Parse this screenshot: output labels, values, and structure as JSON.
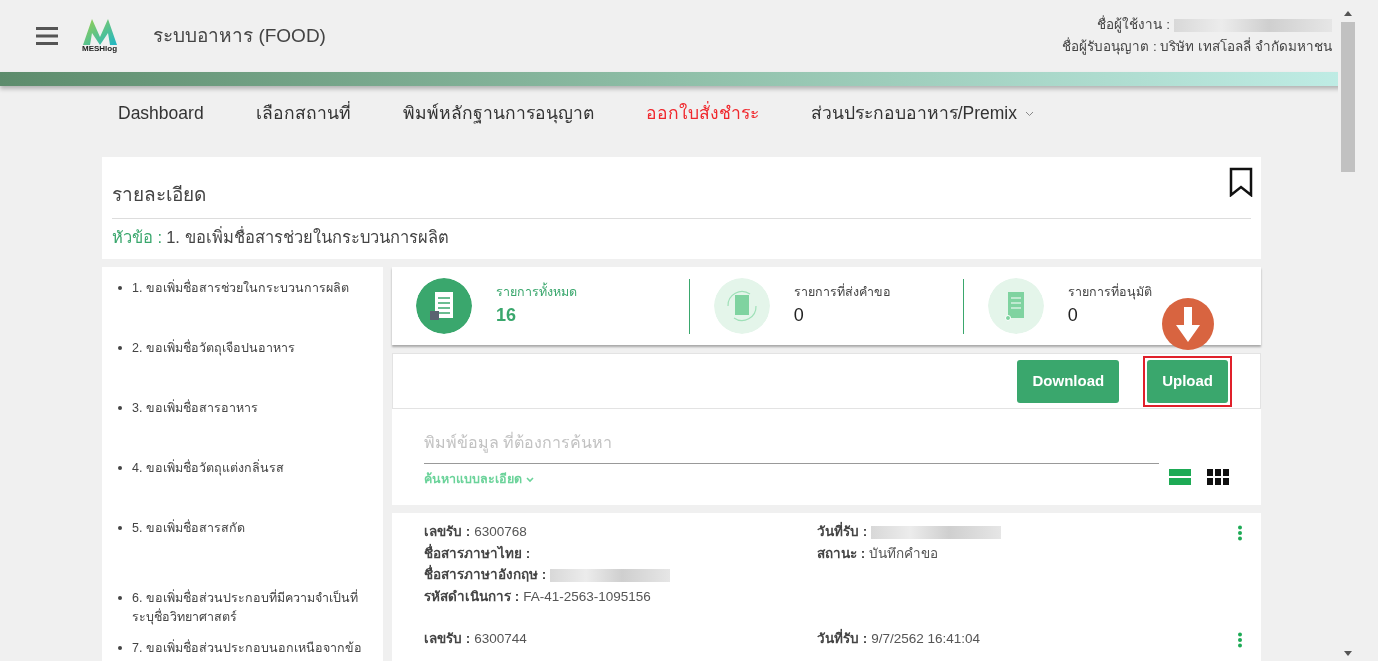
{
  "header": {
    "app_title": "ระบบอาหาร (FOOD)",
    "logo_text": "MESHlog",
    "user_label": "ชื่อผู้ใช้งาน :",
    "user_blurred": true,
    "licensee": "ชื่อผู้รับอนุญาต : บริษัท เทสโอลลี่ จำกัดมหาชน"
  },
  "nav": [
    {
      "label": "Dashboard",
      "selected": false,
      "kind": "link"
    },
    {
      "label": "เลือกสถานที่",
      "selected": false,
      "kind": "link"
    },
    {
      "label": "พิมพ์หลักฐานการอนุญาต",
      "selected": false,
      "kind": "link"
    },
    {
      "label": "ออกใบสั่งชำระ",
      "selected": true,
      "kind": "link"
    },
    {
      "label": "ส่วนประกอบอาหาร/Premix",
      "selected": false,
      "kind": "menu"
    }
  ],
  "detail": {
    "title": "รายละเอียด",
    "topic_label": "หัวข้อ :",
    "topic": "1. ขอเพิ่มชื่อสารช่วยในกระบวนการผลิต"
  },
  "sidebar": {
    "items": [
      {
        "label": "1. ขอเพิ่มชื่อสารช่วยในกระบวนการผลิต"
      },
      {
        "label": "2. ขอเพิ่มชื่อวัตถุเจือปนอาหาร"
      },
      {
        "label": "3. ขอเพิ่มชื่อสารอาหาร"
      },
      {
        "label": "4. ขอเพิ่มชื่อวัตถุแต่งกลิ่นรส"
      },
      {
        "label": "5. ขอเพิ่มชื่อสารสกัด"
      },
      {
        "label": "6. ขอเพิ่มชื่อส่วนประกอบที่มีความจำเป็นที่ระบุชื่อวิทยาศาสตร์"
      },
      {
        "label": "7. ขอเพิ่มชื่อส่วนประกอบนอกเหนือจากข้อ"
      }
    ]
  },
  "stats": [
    {
      "kind": "total",
      "label": "รายการทั้งหมด",
      "count": "16",
      "selected": true
    },
    {
      "kind": "sent",
      "label": "รายการที่ส่งคำขอ",
      "count": "0",
      "selected": false
    },
    {
      "kind": "approved",
      "label": "รายการที่อนุมัติ",
      "count": "0",
      "selected": false
    }
  ],
  "actions": [
    {
      "label": "Download",
      "highlighted": false
    },
    {
      "label": "Upload",
      "highlighted": true
    }
  ],
  "search": {
    "placeholder": "พิมพ์ข้อมูล ที่ต้องการค้นหา",
    "advanced_link": "ค้นหาแบบละเอียด"
  },
  "view_toggle": [
    {
      "kind": "list",
      "selected": true
    },
    {
      "kind": "grid",
      "selected": false
    }
  ],
  "records": [
    {
      "left": [
        {
          "label": "เลขรับ :",
          "value": "6300768",
          "blurred": false
        },
        {
          "label": "ชื่อสารภาษาไทย :",
          "blurred": false
        },
        {
          "label": "ชื่อสารภาษาอังกฤษ :",
          "blurred": true
        },
        {
          "label": "รหัสดำเนินการ :",
          "value": "FA-41-2563-1095156",
          "blurred": false
        }
      ],
      "right": [
        {
          "label": "วันที่รับ :",
          "blurred": true
        },
        {
          "label": "สถานะ :",
          "value": "บันทึกคำขอ",
          "blurred": false
        }
      ]
    },
    {
      "left": [
        {
          "label": "เลขรับ :",
          "value": "6300744",
          "blurred": false
        }
      ],
      "right": [
        {
          "label": "วันที่รับ :",
          "value": "9/7/2562 16:41:04",
          "blurred": false
        }
      ]
    }
  ]
}
